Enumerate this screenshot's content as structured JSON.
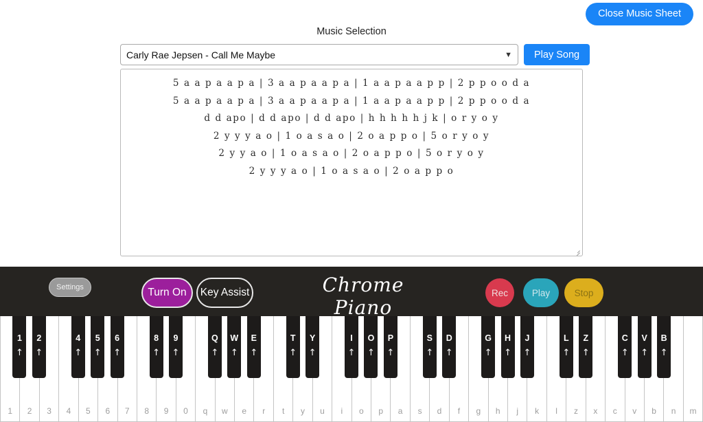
{
  "header": {
    "close_button": "Close Music Sheet"
  },
  "music_selection": {
    "label": "Music Selection",
    "selected_song": "Carly Rae Jepsen - Call Me Maybe",
    "options": [
      "Carly Rae Jepsen - Call Me Maybe"
    ],
    "dropdown_icon": "chevron-down-icon",
    "play_song_button": "Play Song"
  },
  "music_sheet": {
    "lines": [
      "5 a a p a a p a | 3 a a p a a p a | 1 a a p a a p p | 2 p p o o d a",
      "5 a a p a a p a | 3 a a p a a p a | 1 a a p a a p p | 2 p p o o d a",
      "d d apo | d d apo | d d apo | h h h h h j k | o r y o y",
      "2 y y y a o | 1 o a s a o | 2 o a p p o | 5 o r y o y",
      "2 y y a o | 1 o a s a o | 2 o a p p o | 5 o r y o y",
      "2 y y y a o | 1 o a s a o | 2 o a p p o"
    ]
  },
  "controls": {
    "settings_button": "Settings",
    "turn_on_button": "Turn On",
    "key_assist_button": "Key Assist",
    "brand": "Chrome Piano",
    "rec_button": "Rec",
    "play_button": "Play",
    "stop_button": "Stop"
  },
  "colors": {
    "accent_blue": "#1a85f7",
    "bar_dark": "#262421",
    "turn_on_purple": "#9c1f9c",
    "rec_red": "#d83a4e",
    "play_teal": "#2aa5ba",
    "stop_gold": "#dcae1d",
    "settings_gray": "#9a9a9a"
  },
  "keyboard": {
    "white_keys": [
      "1",
      "2",
      "3",
      "4",
      "5",
      "6",
      "7",
      "8",
      "9",
      "0",
      "q",
      "w",
      "e",
      "r",
      "t",
      "y",
      "u",
      "i",
      "o",
      "p",
      "a",
      "s",
      "d",
      "f",
      "g",
      "h",
      "j",
      "k",
      "l",
      "z",
      "x",
      "c",
      "v",
      "b",
      "n",
      "m"
    ],
    "black_keys": [
      {
        "label": "1",
        "after_white_index": 0
      },
      {
        "label": "2",
        "after_white_index": 1
      },
      {
        "label": "4",
        "after_white_index": 3
      },
      {
        "label": "5",
        "after_white_index": 4
      },
      {
        "label": "6",
        "after_white_index": 5
      },
      {
        "label": "8",
        "after_white_index": 7
      },
      {
        "label": "9",
        "after_white_index": 8
      },
      {
        "label": "Q",
        "after_white_index": 10
      },
      {
        "label": "W",
        "after_white_index": 11
      },
      {
        "label": "E",
        "after_white_index": 12
      },
      {
        "label": "T",
        "after_white_index": 14
      },
      {
        "label": "Y",
        "after_white_index": 15
      },
      {
        "label": "I",
        "after_white_index": 17
      },
      {
        "label": "O",
        "after_white_index": 18
      },
      {
        "label": "P",
        "after_white_index": 19
      },
      {
        "label": "S",
        "after_white_index": 21
      },
      {
        "label": "D",
        "after_white_index": 22
      },
      {
        "label": "G",
        "after_white_index": 24
      },
      {
        "label": "H",
        "after_white_index": 25
      },
      {
        "label": "J",
        "after_white_index": 26
      },
      {
        "label": "L",
        "after_white_index": 28
      },
      {
        "label": "Z",
        "after_white_index": 29
      },
      {
        "label": "C",
        "after_white_index": 31
      },
      {
        "label": "V",
        "after_white_index": 32
      },
      {
        "label": "B",
        "after_white_index": 33
      }
    ],
    "shift_arrow_glyph": "↑"
  }
}
